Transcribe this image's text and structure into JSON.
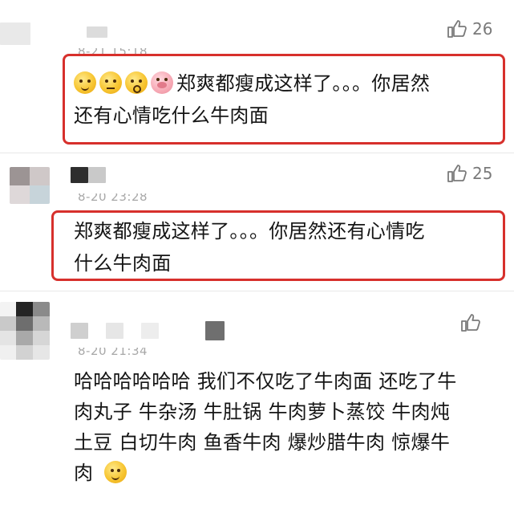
{
  "comments": [
    {
      "timestamp": "8-21 15:18",
      "likes": "26",
      "emoji_icons": [
        "crying-laughing-emoji-icon",
        "thinking-emoji-icon",
        "shocked-emoji-icon",
        "pig-emoji-icon"
      ],
      "text_line1": "郑爽都瘦成这样了。。。你居然",
      "text_line2": "还有心情吃什么牛肉面"
    },
    {
      "timestamp": "8-20 23:28",
      "likes": "25",
      "text_line1": "郑爽都瘦成这样了。。。你居然还有心情吃",
      "text_line2": "什么牛肉面"
    },
    {
      "timestamp": "8-20 21:34",
      "likes": "",
      "text_line1": "哈哈哈哈哈哈 我们不仅吃了牛肉面 还吃了牛",
      "text_line2": "肉丸子 牛杂汤 牛肚锅 牛肉萝卜蒸饺 牛肉炖",
      "text_line3": "土豆 白切牛肉 鱼香牛肉 爆炒腊牛肉 惊爆牛",
      "text_line4": "肉",
      "trailing_emoji": "smile-emoji-icon"
    }
  ],
  "colors": {
    "highlight_border": "#d7302c",
    "timestamp": "#a8a8a8",
    "like": "#7a7a7a"
  }
}
